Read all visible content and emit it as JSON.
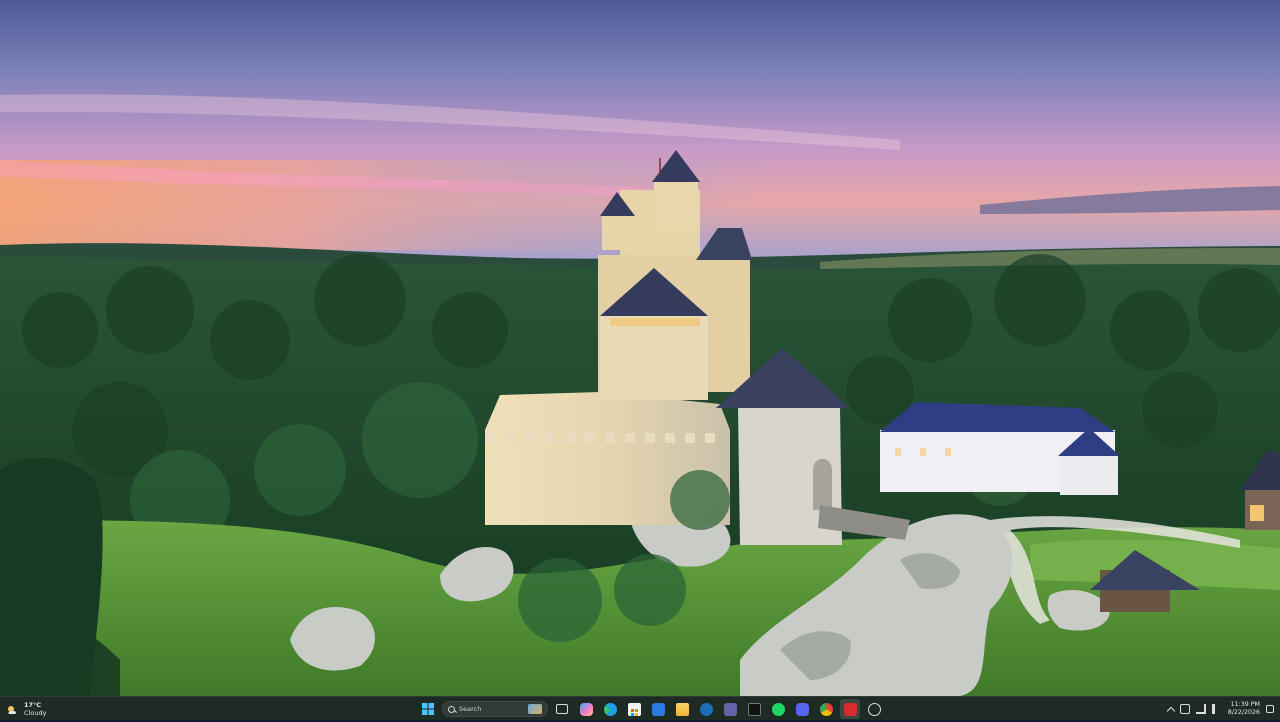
{
  "desktop": {
    "wallpaper": {
      "colors": {
        "sky_top": "#5f6fa6",
        "sky_mid": "#b58fc5",
        "sunset_band": "#f1a07c",
        "forest": "#1f4a2c",
        "meadow": "#5f9a3a",
        "castle_wall": "#d8d2bb",
        "roof": "#3a4262"
      }
    }
  },
  "taskbar": {
    "background": "#1d2b24",
    "weather": {
      "temperature": "17°C",
      "condition": "Cloudy",
      "icon": "cloud-icon"
    },
    "search": {
      "placeholder": "Search"
    },
    "pinned_apps": [
      {
        "name": "start-button",
        "icon": "windows-logo-icon"
      },
      {
        "name": "task-view",
        "icon": "task-view-icon"
      },
      {
        "name": "copilot",
        "icon": "copilot-icon"
      },
      {
        "name": "edge",
        "icon": "edge-icon"
      },
      {
        "name": "store",
        "icon": "store-icon"
      },
      {
        "name": "mail",
        "icon": "mail-icon"
      },
      {
        "name": "file-explorer",
        "icon": "folder-icon"
      },
      {
        "name": "steam",
        "icon": "steam-icon"
      },
      {
        "name": "teams",
        "icon": "teams-icon"
      },
      {
        "name": "terminal",
        "icon": "terminal-icon"
      },
      {
        "name": "spotify",
        "icon": "spotify-icon"
      },
      {
        "name": "discord",
        "icon": "discord-icon"
      },
      {
        "name": "chrome",
        "icon": "chrome-icon"
      },
      {
        "name": "app-red",
        "icon": "app-red-icon"
      },
      {
        "name": "app-extra",
        "icon": "app-extra-icon"
      }
    ],
    "tray": {
      "time": "11:39 PM",
      "date": "8/22/2026"
    }
  }
}
